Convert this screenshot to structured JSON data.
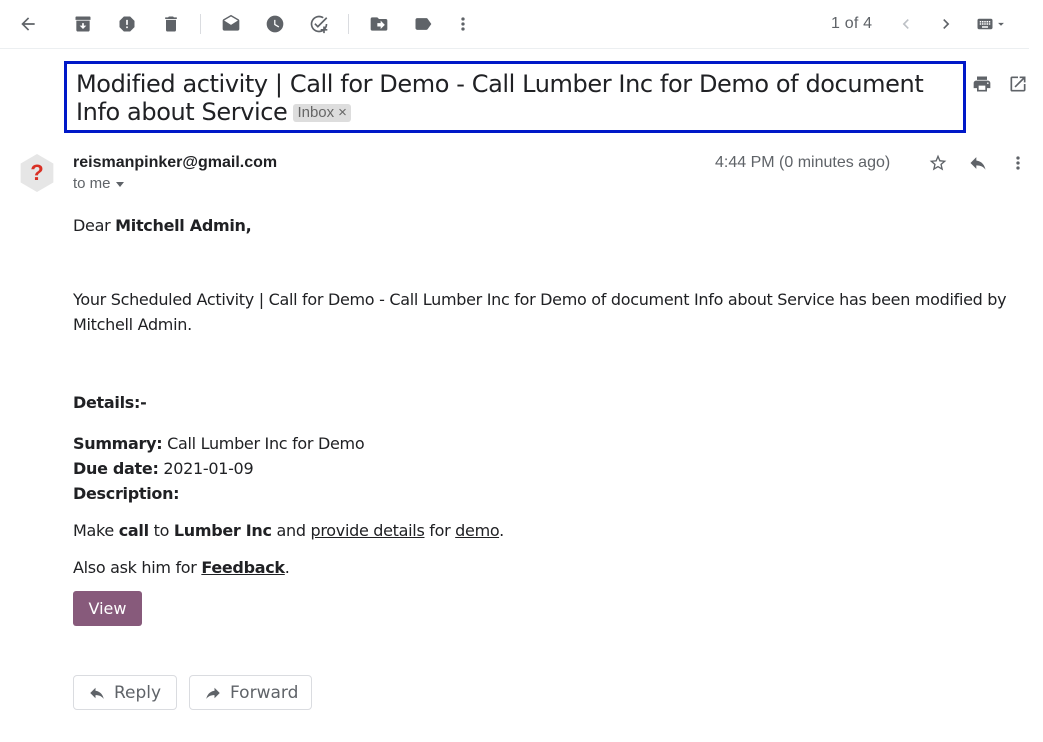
{
  "toolbar": {
    "icons": [
      "back-arrow-icon",
      "archive-icon",
      "report-spam-icon",
      "delete-icon",
      "mark-unread-icon",
      "snooze-icon",
      "add-task-icon",
      "move-to-icon",
      "labels-icon",
      "more-vert-icon"
    ],
    "pager": "1 of 4"
  },
  "subject": {
    "title": "Modified activity | Call for Demo - Call Lumber Inc for Demo of document Info about Service",
    "label": "Inbox",
    "label_close": "×"
  },
  "message": {
    "avatar_glyph": "?",
    "sender": "reismanpinker@gmail.com",
    "recipient": "to me",
    "time": "4:44 PM (0 minutes ago)",
    "greeting_prefix": "Dear ",
    "greeting_name": "Mitchell Admin,",
    "intro": "Your Scheduled Activity | Call for Demo - Call Lumber Inc for Demo of document Info about Service has been modified by Mitchell Admin.",
    "details_heading": "Details:-",
    "summary_label": "Summary:",
    "summary_value": " Call Lumber Inc for Demo",
    "due_label": "Due date:",
    "due_value": " 2021-01-09",
    "description_label": "Description:",
    "desc_make": "Make ",
    "desc_call": "call",
    "desc_to": " to ",
    "desc_company": "Lumber Inc",
    "desc_and": " and ",
    "desc_link1": "provide details",
    "desc_for": " for ",
    "desc_link2": "demo",
    "desc_end": ".",
    "ask_prefix": "Also ask him for ",
    "ask_link": "Feedback",
    "ask_end": ".",
    "view_button": "View"
  },
  "actions": {
    "reply": "Reply",
    "forward": "Forward"
  },
  "colors": {
    "accent_view_button": "#875a7b",
    "highlight_border": "#0018c8",
    "avatar_glyph": "#d93025"
  }
}
